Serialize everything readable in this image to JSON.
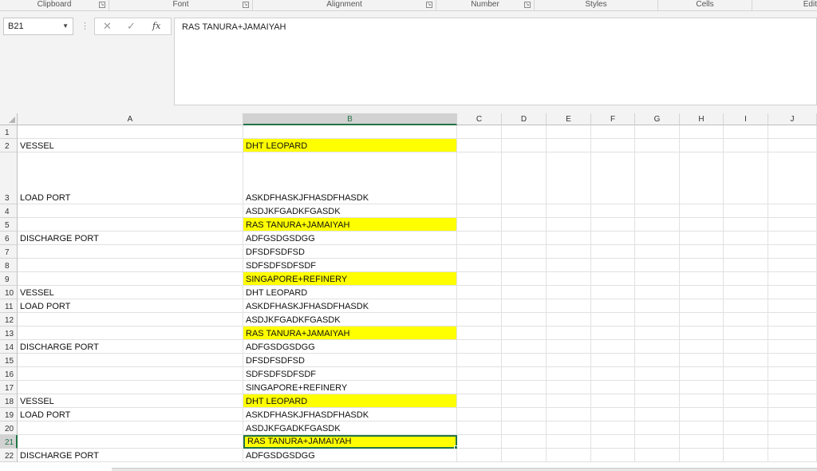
{
  "ribbon": {
    "groups": [
      "Clipboard",
      "Font",
      "Alignment",
      "Number",
      "Styles",
      "Cells",
      "Edit"
    ]
  },
  "formula_bar": {
    "name_box": "B21",
    "cancel_icon": "✕",
    "enter_icon": "✓",
    "function_icon": "fx",
    "content": "RAS TANURA+JAMAIYAH"
  },
  "sheet": {
    "columns": [
      "A",
      "B",
      "C",
      "D",
      "E",
      "F",
      "G",
      "H",
      "I",
      "J"
    ],
    "selected_cell": "B21",
    "highlight_color": "#ffff00",
    "accent_color": "#217346",
    "rows": [
      {
        "num": "1",
        "a": "",
        "b": "",
        "hl": false
      },
      {
        "num": "2",
        "a": "VESSEL",
        "b": "DHT LEOPARD",
        "hl": true
      },
      {
        "num": "3",
        "a": "LOAD PORT",
        "b": "ASKDFHASKJFHASDFHASDK",
        "hl": false
      },
      {
        "num": "4",
        "a": "",
        "b": "ASDJKFGADKFGASDK",
        "hl": false
      },
      {
        "num": "5",
        "a": "",
        "b": "RAS TANURA+JAMAIYAH",
        "hl": true
      },
      {
        "num": "6",
        "a": "DISCHARGE PORT",
        "b": "ADFGSDGSDGG",
        "hl": false
      },
      {
        "num": "7",
        "a": "",
        "b": "DFSDFSDFSD",
        "hl": false
      },
      {
        "num": "8",
        "a": "",
        "b": "SDFSDFSDFSDF",
        "hl": false
      },
      {
        "num": "9",
        "a": "",
        "b": "SINGAPORE+REFINERY",
        "hl": true
      },
      {
        "num": "10",
        "a": "VESSEL",
        "b": "DHT LEOPARD",
        "hl": false
      },
      {
        "num": "11",
        "a": "LOAD PORT",
        "b": "ASKDFHASKJFHASDFHASDK",
        "hl": false
      },
      {
        "num": "12",
        "a": "",
        "b": "ASDJKFGADKFGASDK",
        "hl": false
      },
      {
        "num": "13",
        "a": "",
        "b": "RAS TANURA+JAMAIYAH",
        "hl": true
      },
      {
        "num": "14",
        "a": "DISCHARGE PORT",
        "b": "ADFGSDGSDGG",
        "hl": false
      },
      {
        "num": "15",
        "a": "",
        "b": "DFSDFSDFSD",
        "hl": false
      },
      {
        "num": "16",
        "a": "",
        "b": "SDFSDFSDFSDF",
        "hl": false
      },
      {
        "num": "17",
        "a": "",
        "b": "SINGAPORE+REFINERY",
        "hl": false
      },
      {
        "num": "18",
        "a": "VESSEL",
        "b": "DHT LEOPARD",
        "hl": true
      },
      {
        "num": "19",
        "a": "LOAD PORT",
        "b": "ASKDFHASKJFHASDFHASDK",
        "hl": false
      },
      {
        "num": "20",
        "a": "",
        "b": "ASDJKFGADKFGASDK",
        "hl": false
      },
      {
        "num": "21",
        "a": "",
        "b": "RAS TANURA+JAMAIYAH",
        "hl": true
      },
      {
        "num": "22",
        "a": "DISCHARGE PORT",
        "b": "ADFGSDGSDGG",
        "hl": false
      }
    ]
  }
}
